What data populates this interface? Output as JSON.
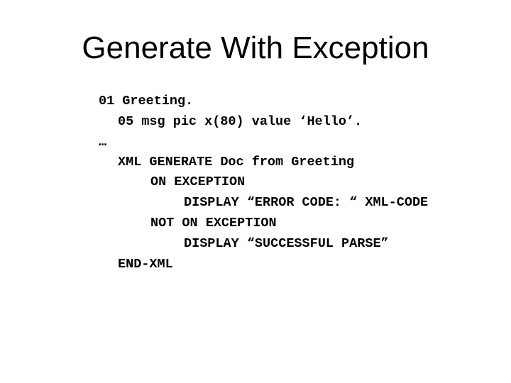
{
  "slide": {
    "title": "Generate With Exception",
    "code_lines": [
      {
        "indent_level": 0,
        "text": "01 Greeting."
      },
      {
        "indent_level": 1,
        "text": "05 msg pic x(80) value ‘Hello’."
      },
      {
        "indent_level": 0,
        "text": "…"
      },
      {
        "indent_level": 1,
        "text": "XML GENERATE Doc from Greeting"
      },
      {
        "indent_level": 2,
        "text": "ON EXCEPTION"
      },
      {
        "indent_level": 3,
        "text": "DISPLAY “ERROR CODE: “ XML-CODE"
      },
      {
        "indent_level": 2,
        "text": "NOT ON EXCEPTION"
      },
      {
        "indent_level": 3,
        "text": "DISPLAY “SUCCESSFUL PARSE”"
      },
      {
        "indent_level": 1,
        "text": "END-XML"
      }
    ]
  }
}
